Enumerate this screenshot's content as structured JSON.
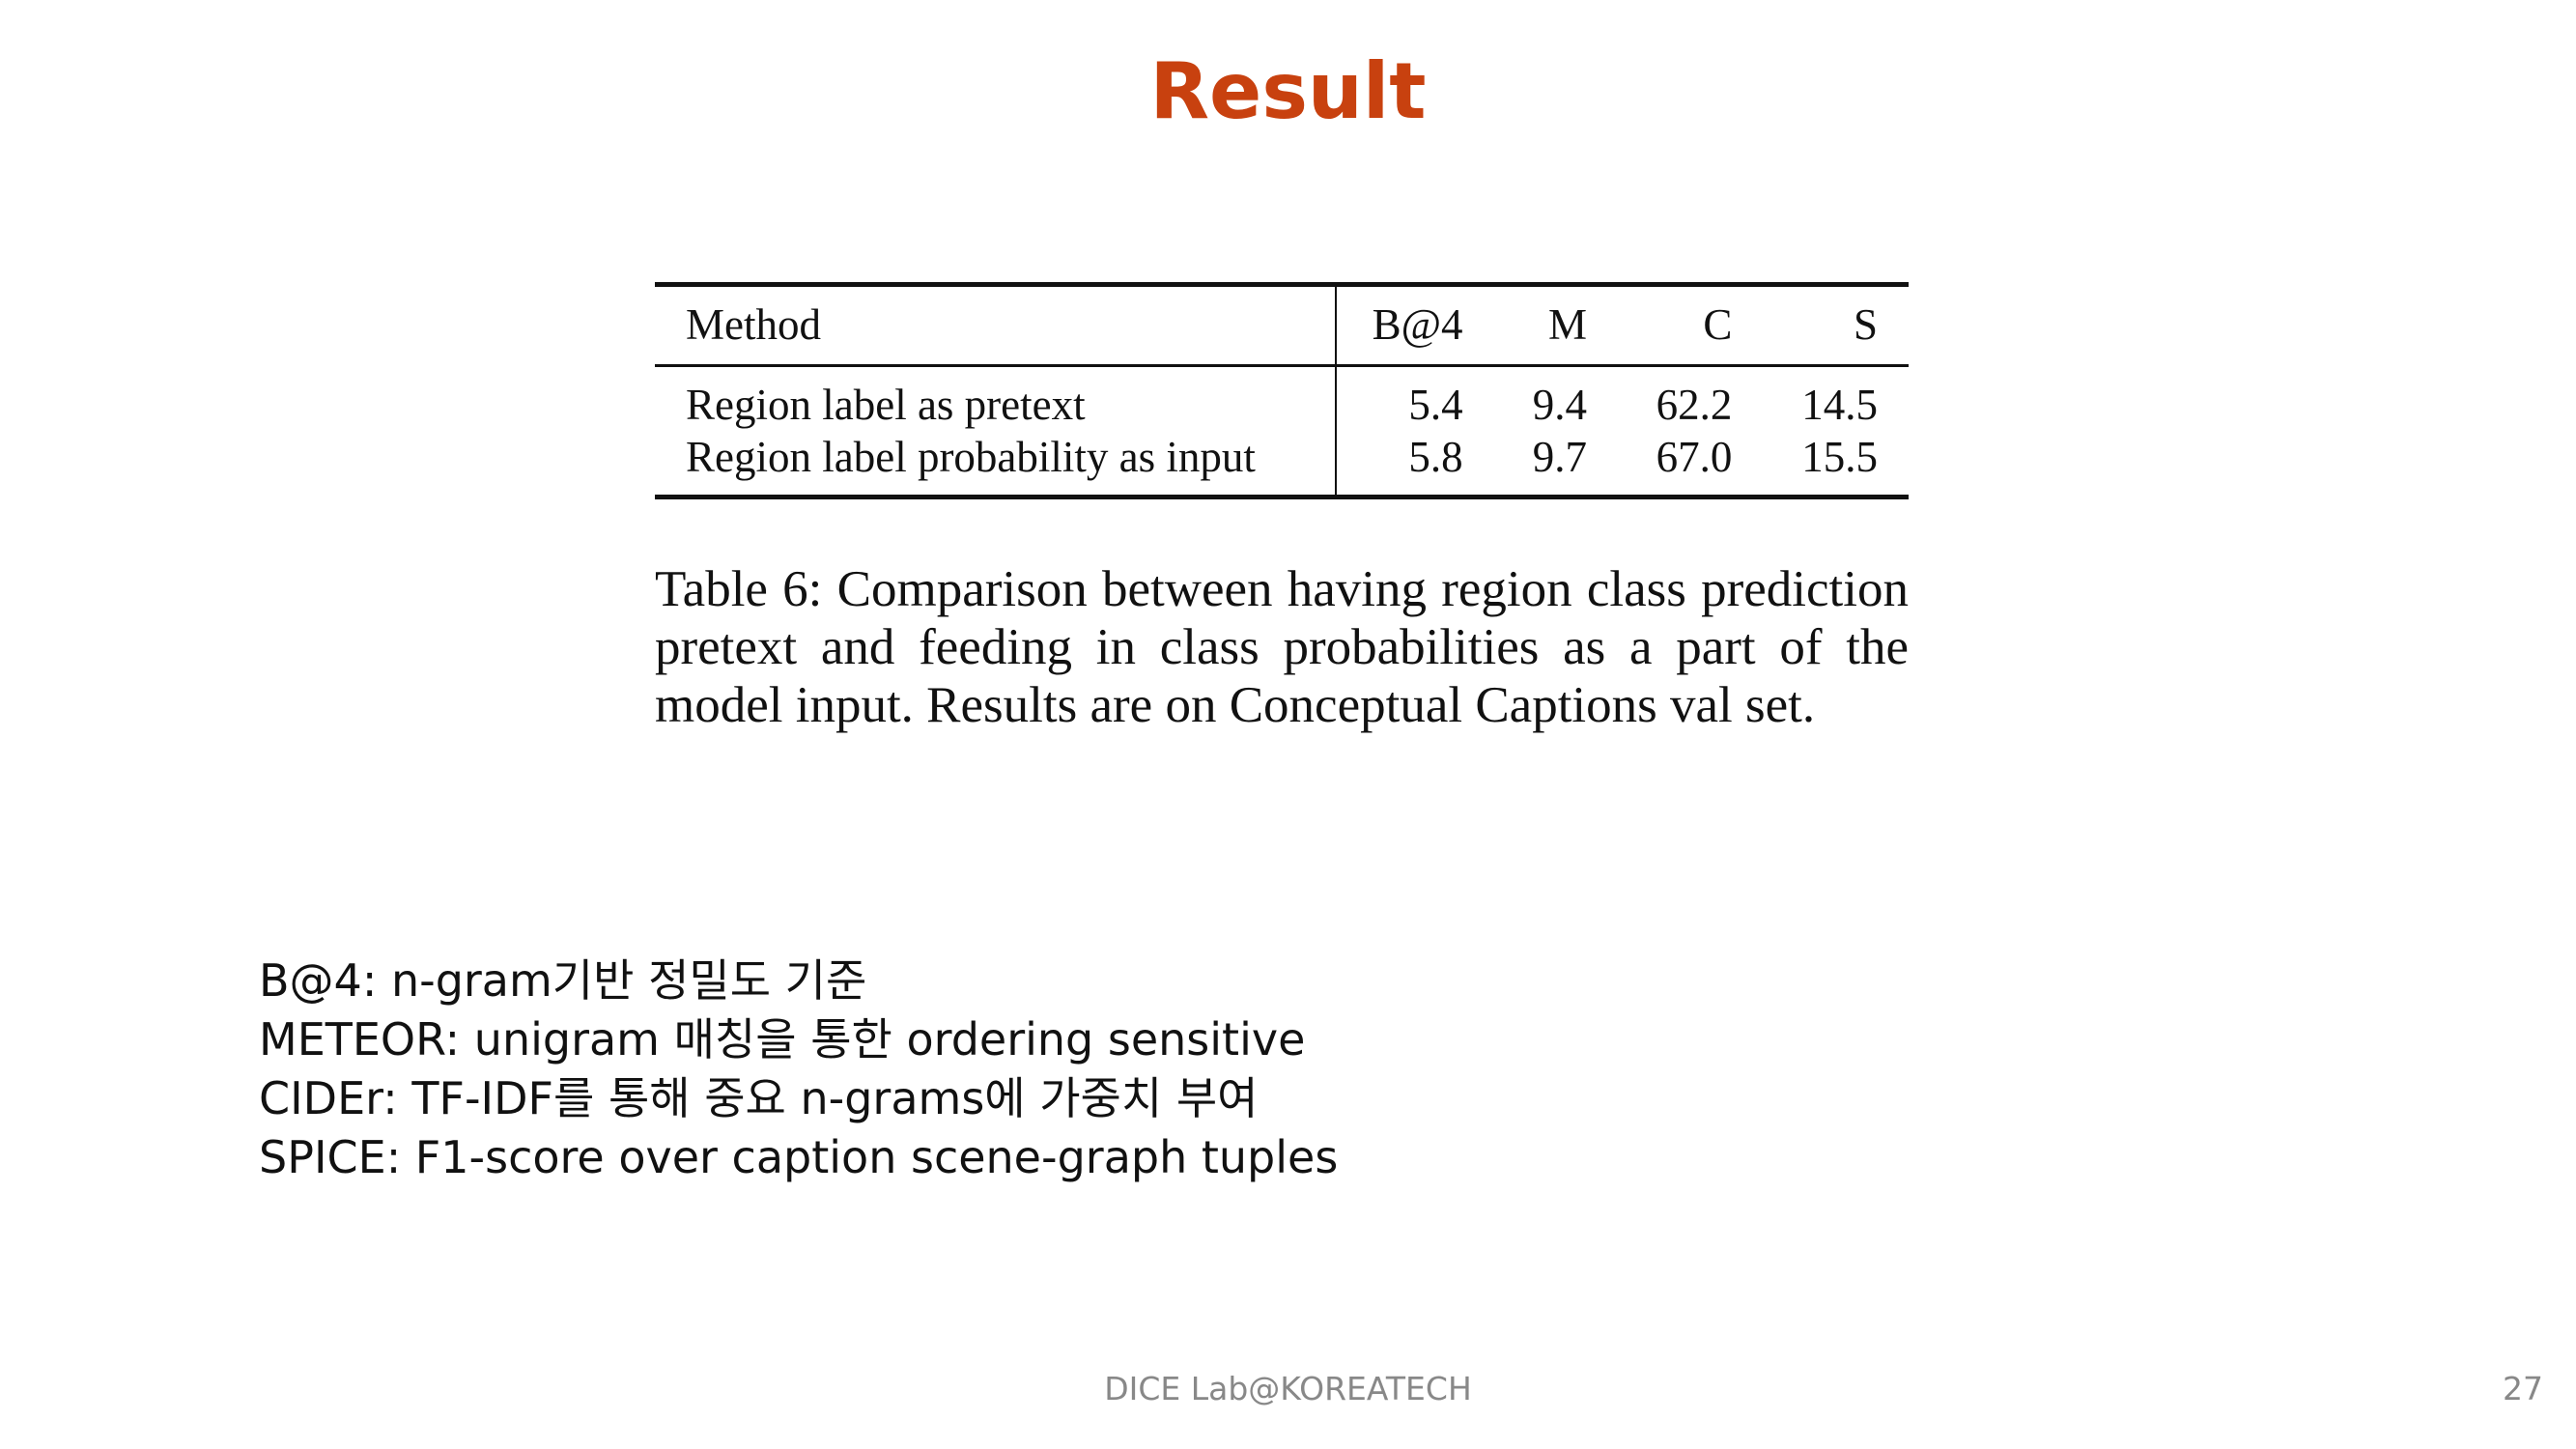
{
  "slide": {
    "title": "Result",
    "footer": "DICE Lab@KOREATECH",
    "page_number": "27"
  },
  "table": {
    "headers": [
      "Method",
      "B@4",
      "M",
      "C",
      "S"
    ],
    "rows": [
      {
        "method": "Region label as pretext",
        "b4": "5.4",
        "m": "9.4",
        "c": "62.2",
        "s": "14.5"
      },
      {
        "method": "Region label probability as input",
        "b4": "5.8",
        "m": "9.7",
        "c": "67.0",
        "s": "15.5"
      }
    ],
    "caption": "Table 6: Comparison between having region class prediction pretext and feeding in class probabilities as a part of the model input. Results are on Conceptual Captions val set."
  },
  "notes": [
    "B@4: n-gram기반 정밀도 기준",
    "METEOR: unigram 매칭을 통한 ordering sensitive",
    "CIDEr: TF-IDF를 통해 중요 n-grams에 가중치 부여",
    "SPICE: F1-score over caption scene-graph tuples"
  ]
}
